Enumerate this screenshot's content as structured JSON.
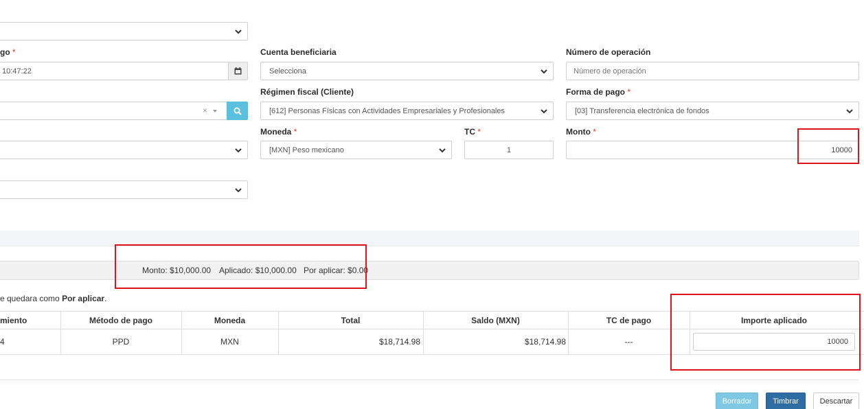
{
  "form": {
    "top_select": {
      "value": ""
    },
    "fecha": {
      "label_suffix": "go",
      "value": "10:47:22"
    },
    "cliente": {
      "value": ""
    },
    "field_row4": {
      "value": ""
    },
    "field_row5": {
      "value": ""
    },
    "cuenta_beneficiaria": {
      "label": "Cuenta beneficiaria",
      "value": "Selecciona"
    },
    "regimen_fiscal": {
      "label": "Régimen fiscal (Cliente)",
      "value": "[612] Personas Físicas con Actividades Empresariales y Profesionales"
    },
    "moneda": {
      "label": "Moneda",
      "value": "[MXN] Peso mexicano"
    },
    "tc": {
      "label": "TC",
      "value": "1"
    },
    "numero_operacion": {
      "label": "Número de operación",
      "placeholder": "Número de operación"
    },
    "forma_pago": {
      "label": "Forma de pago",
      "value": "[03] Transferencia electrónica de fondos"
    },
    "monto": {
      "label": "Monto",
      "value": "10000"
    },
    "required_mark": "*",
    "clear_glyph": "×"
  },
  "summary": {
    "monto": "Monto: $10,000.00",
    "aplicado": "Aplicado: $10,000.00",
    "por_aplicar": "Por aplicar: $0.00"
  },
  "note": {
    "prefix": "e quedara como ",
    "bold": "Por aplicar",
    "suffix": "."
  },
  "table": {
    "headers": [
      "miento",
      "Método de pago",
      "Moneda",
      "Total",
      "Saldo (MXN)",
      "TC de pago",
      "Importe aplicado"
    ],
    "rows": [
      [
        "4",
        "PPD",
        "MXN",
        "$18,714.98",
        "$18,714.98",
        "---",
        "10000"
      ]
    ]
  },
  "buttons": {
    "borrador": "Borrador",
    "timbrar": "Timbrar",
    "descartar": "Descartar"
  },
  "colors": {
    "highlight": "#e0121b",
    "search_button": "#5bc0de",
    "borrador": "#7fc8e3",
    "timbrar": "#2e6da4",
    "required": "#e0352b"
  }
}
